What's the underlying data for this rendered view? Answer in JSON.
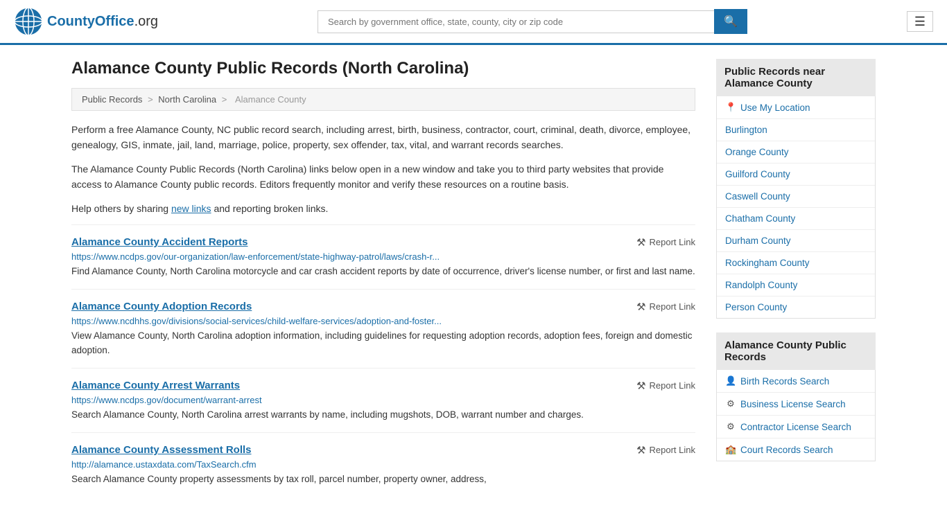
{
  "header": {
    "logo_text": "CountyOffice",
    "logo_suffix": ".org",
    "search_placeholder": "Search by government office, state, county, city or zip code",
    "search_value": ""
  },
  "page": {
    "title": "Alamance County Public Records (North Carolina)",
    "breadcrumb": [
      "Public Records",
      "North Carolina",
      "Alamance County"
    ],
    "description1": "Perform a free Alamance County, NC public record search, including arrest, birth, business, contractor, court, criminal, death, divorce, employee, genealogy, GIS, inmate, jail, land, marriage, police, property, sex offender, tax, vital, and warrant records searches.",
    "description2": "The Alamance County Public Records (North Carolina) links below open in a new window and take you to third party websites that provide access to Alamance County public records. Editors frequently monitor and verify these resources on a routine basis.",
    "description3_pre": "Help others by sharing ",
    "description3_link": "new links",
    "description3_post": " and reporting broken links."
  },
  "records": [
    {
      "title": "Alamance County Accident Reports",
      "url": "https://www.ncdps.gov/our-organization/law-enforcement/state-highway-patrol/laws/crash-r...",
      "desc": "Find Alamance County, North Carolina motorcycle and car crash accident reports by date of occurrence, driver's license number, or first and last name.",
      "report_label": "Report Link"
    },
    {
      "title": "Alamance County Adoption Records",
      "url": "https://www.ncdhhs.gov/divisions/social-services/child-welfare-services/adoption-and-foster...",
      "desc": "View Alamance County, North Carolina adoption information, including guidelines for requesting adoption records, adoption fees, foreign and domestic adoption.",
      "report_label": "Report Link"
    },
    {
      "title": "Alamance County Arrest Warrants",
      "url": "https://www.ncdps.gov/document/warrant-arrest",
      "desc": "Search Alamance County, North Carolina arrest warrants by name, including mugshots, DOB, warrant number and charges.",
      "report_label": "Report Link"
    },
    {
      "title": "Alamance County Assessment Rolls",
      "url": "http://alamance.ustaxdata.com/TaxSearch.cfm",
      "desc": "Search Alamance County property assessments by tax roll, parcel number, property owner, address,",
      "report_label": "Report Link"
    }
  ],
  "sidebar": {
    "nearby_header": "Public Records near Alamance County",
    "nearby_items": [
      {
        "label": "Use My Location",
        "icon": "📍",
        "type": "location"
      },
      {
        "label": "Burlington",
        "icon": "",
        "type": "link"
      },
      {
        "label": "Orange County",
        "icon": "",
        "type": "link"
      },
      {
        "label": "Guilford County",
        "icon": "",
        "type": "link"
      },
      {
        "label": "Caswell County",
        "icon": "",
        "type": "link"
      },
      {
        "label": "Chatham County",
        "icon": "",
        "type": "link"
      },
      {
        "label": "Durham County",
        "icon": "",
        "type": "link"
      },
      {
        "label": "Rockingham County",
        "icon": "",
        "type": "link"
      },
      {
        "label": "Randolph County",
        "icon": "",
        "type": "link"
      },
      {
        "label": "Person County",
        "icon": "",
        "type": "link"
      }
    ],
    "records_header": "Alamance County Public Records",
    "records_items": [
      {
        "label": "Birth Records Search",
        "icon": "👤"
      },
      {
        "label": "Business License Search",
        "icon": "⚙️"
      },
      {
        "label": "Contractor License Search",
        "icon": "⚙️"
      },
      {
        "label": "Court Records Search",
        "icon": "🏛️"
      }
    ]
  }
}
